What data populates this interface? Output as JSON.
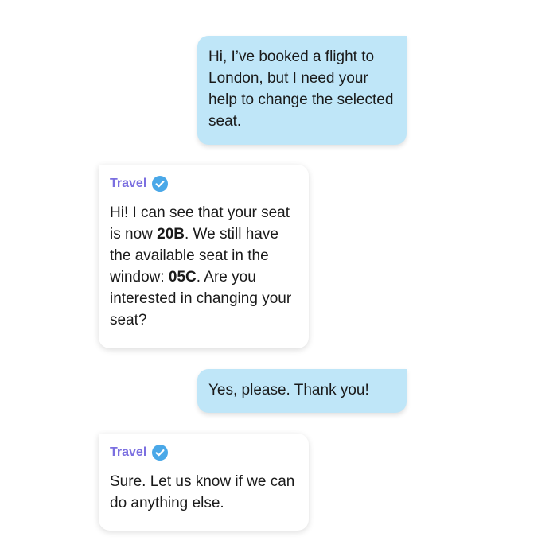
{
  "conversation": {
    "messages": [
      {
        "role": "user",
        "text": "Hi, I’ve booked a flight to London, but I need your help to change the selected seat."
      },
      {
        "role": "bot",
        "sender": "Travel",
        "parts": [
          "Hi! I can see that your seat is now ",
          "20B",
          ". We still have the available seat in the window: ",
          "05C",
          ". Are you interested in changing your seat?"
        ]
      },
      {
        "role": "user",
        "text": "Yes, please. Thank you!"
      },
      {
        "role": "bot",
        "sender": "Travel",
        "text": "Sure. Let us know if we can do anything else."
      }
    ]
  },
  "icons": {
    "verified": "verified-check-icon"
  },
  "colors": {
    "user_bubble": "#bfe6f8",
    "bot_bubble": "#ffffff",
    "sender_name": "#7b6fe0",
    "verified_badge": "#4aa8e8"
  }
}
